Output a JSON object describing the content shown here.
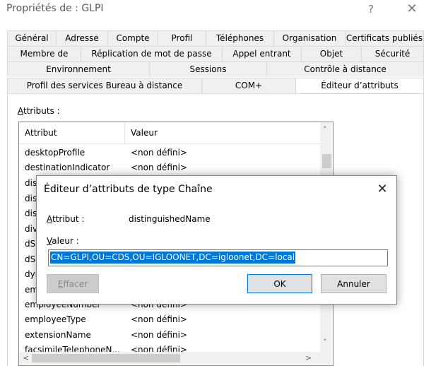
{
  "window": {
    "title": "Propriétés de : GLPI",
    "help_glyph": "?",
    "close_glyph": "✕"
  },
  "tabs": {
    "row1": [
      "Général",
      "Adresse",
      "Compte",
      "Profil",
      "Téléphones",
      "Organisation",
      "Certificats publiés"
    ],
    "row2": [
      "Membre de",
      "Réplication de mot de passe",
      "Appel entrant",
      "Objet",
      "Sécurité"
    ],
    "row3": [
      "Environnement",
      "Sessions",
      "Contrôle à distance"
    ],
    "row4": [
      "Profil des services Bureau à distance",
      "COM+",
      "Éditeur d’attributs"
    ]
  },
  "attributes_panel": {
    "label_first": "A",
    "label_rest": "ttributs :",
    "columns": {
      "attribute": "Attribut",
      "value": "Valeur"
    },
    "rows": [
      {
        "attribute": "desktopProfile",
        "value": "<non défini>"
      },
      {
        "attribute": "destinationIndicator",
        "value": "<non défini>"
      },
      {
        "attribute": "dis",
        "value": ""
      },
      {
        "attribute": "dis",
        "value": ""
      },
      {
        "attribute": "dis",
        "value": ""
      },
      {
        "attribute": "div",
        "value": ""
      },
      {
        "attribute": "dS",
        "value": ""
      },
      {
        "attribute": "dS",
        "value": ""
      },
      {
        "attribute": "dyr",
        "value": ""
      },
      {
        "attribute": "em",
        "value": ""
      },
      {
        "attribute": "employeeNumber",
        "value": "<non défini>"
      },
      {
        "attribute": "employeeType",
        "value": "<non défini>"
      },
      {
        "attribute": "extensionName",
        "value": "<non défini>"
      },
      {
        "attribute": "facsimileTelephoneN...",
        "value": "<non défini>"
      }
    ],
    "scroll_up_glyph": "˄",
    "scroll_down_glyph": "˅",
    "scroll_left_glyph": "<",
    "scroll_right_glyph": ">"
  },
  "dialog": {
    "title": "Éditeur d’attributs de type Chaîne",
    "close_glyph": "✕",
    "attribute_label_first": "A",
    "attribute_label_rest": "ttribut :",
    "attribute_value": "distinguishedName",
    "value_label_first": "V",
    "value_label_rest": "aleur :",
    "value_text": "CN=GLPI,OU=CDS,OU=IGLOONET,DC=igloonet,DC=local",
    "clear_first": "E",
    "clear_rest": "ffacer",
    "ok_label": "OK",
    "cancel_label": "Annuler"
  }
}
